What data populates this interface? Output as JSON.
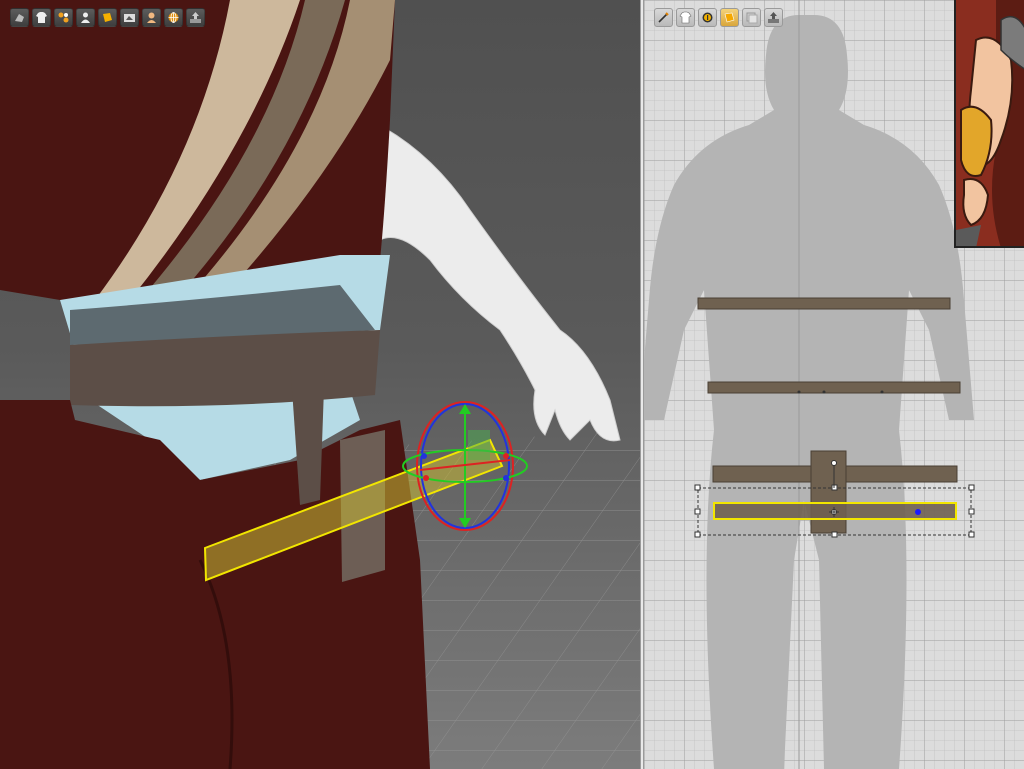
{
  "viewport3d": {
    "toolbar": [
      {
        "icon": "avatar-render-icon"
      },
      {
        "icon": "garment-shirt-icon"
      },
      {
        "icon": "texture-pattern-icon"
      },
      {
        "icon": "avatar-display-icon"
      },
      {
        "icon": "garment-color-icon"
      },
      {
        "icon": "flat-shading-icon"
      },
      {
        "icon": "avatar-skin-icon"
      },
      {
        "icon": "mesh-sphere-icon"
      },
      {
        "icon": "screenshot-export-icon"
      }
    ],
    "colors": {
      "robe": "#4a1512",
      "sash": "#6d5e55",
      "inner_cloth": "#b6dbe6",
      "collar_stripe_light": "#cdb89c",
      "collar_stripe_dark": "#7a6a58",
      "selected_outline": "#f2e600",
      "skin": "#ebebeb"
    }
  },
  "pattern2d": {
    "toolbar": [
      {
        "icon": "edit-pattern-icon",
        "active": false
      },
      {
        "icon": "garment-shirt-icon",
        "active": false
      },
      {
        "icon": "info-icon",
        "active": false
      },
      {
        "icon": "pattern-color-icon",
        "active": true
      },
      {
        "icon": "pattern-overlay-icon",
        "active": false
      },
      {
        "icon": "screenshot-export-icon",
        "active": false
      }
    ],
    "colors": {
      "grid_bg": "#dcdcdc",
      "avatar_silhouette": "#b4b4b4",
      "pattern_fill": "#6f6150",
      "selection_outline": "#f2e600",
      "bbox_dashed": "#333333",
      "point_dot": "#1a1aff"
    }
  }
}
